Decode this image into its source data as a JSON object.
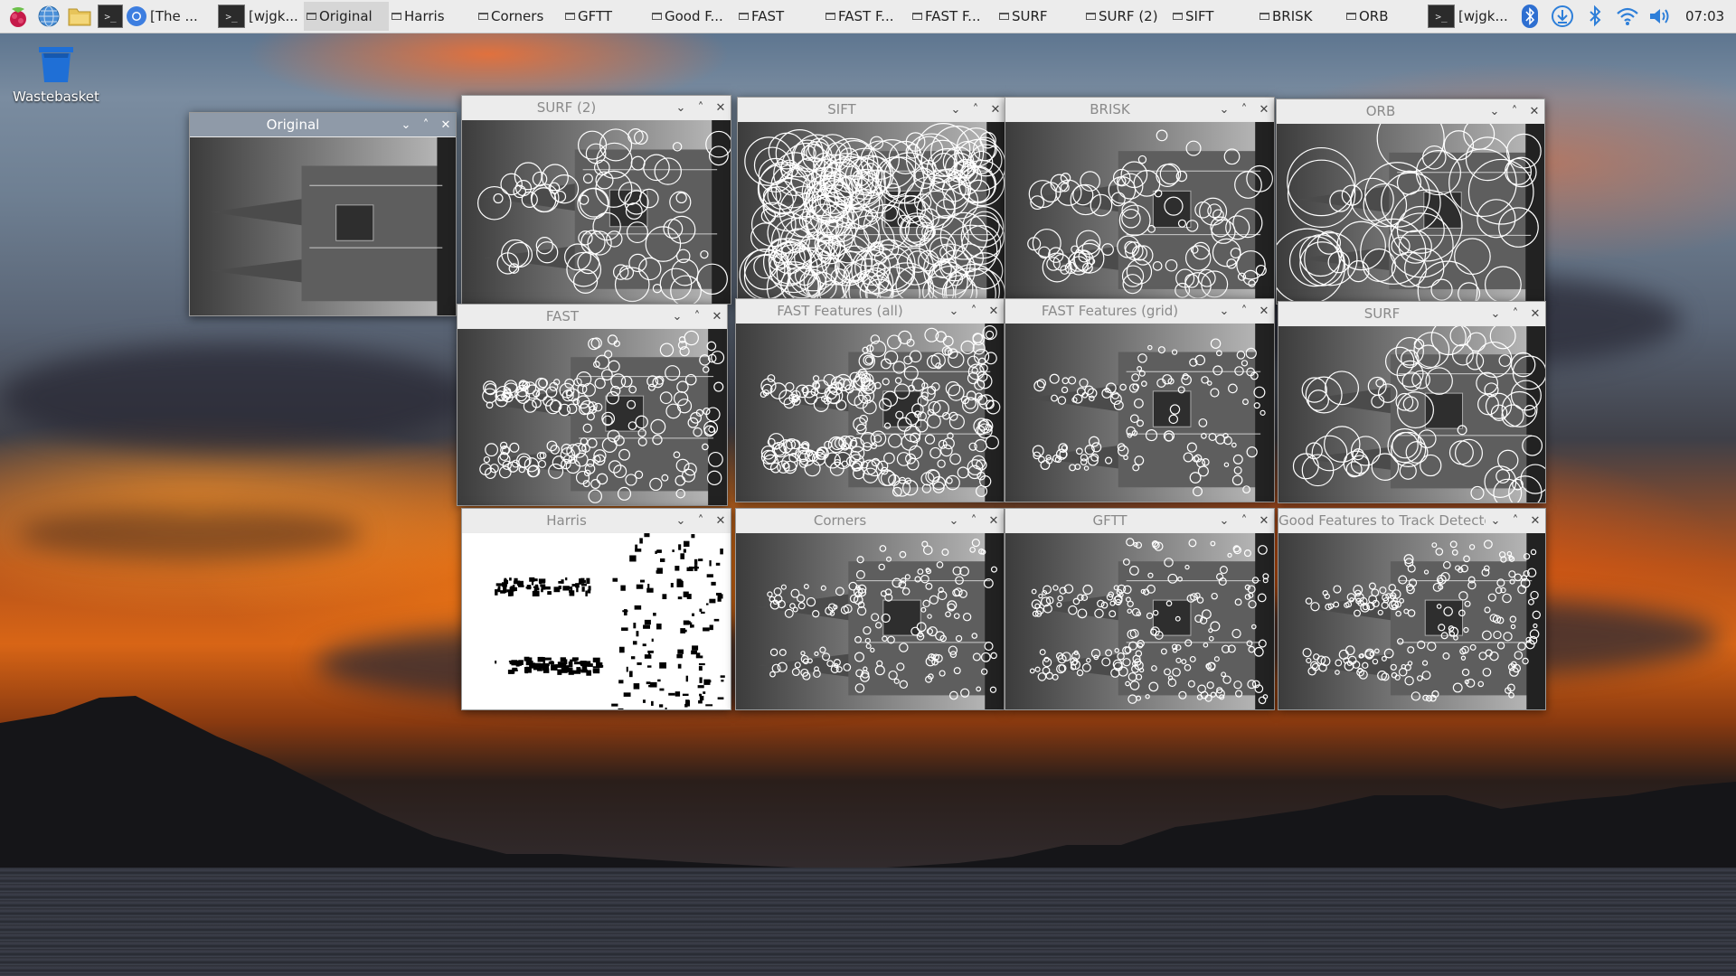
{
  "taskbar": {
    "launchers": [
      {
        "name": "raspberry-menu-icon"
      },
      {
        "name": "web-browser-icon"
      },
      {
        "name": "file-manager-icon"
      },
      {
        "name": "terminal-icon"
      }
    ],
    "tasks": [
      {
        "label": "[The ...",
        "icon": "chromium-icon"
      },
      {
        "label": "[wjgk...",
        "icon": "terminal-icon"
      },
      {
        "label": "Original",
        "icon": "window-icon",
        "active": true
      },
      {
        "label": "Harris",
        "icon": "window-icon"
      },
      {
        "label": "Corners",
        "icon": "window-icon"
      },
      {
        "label": "GFTT",
        "icon": "window-icon"
      },
      {
        "label": "Good F...",
        "icon": "window-icon"
      },
      {
        "label": "FAST",
        "icon": "window-icon"
      },
      {
        "label": "FAST F...",
        "icon": "window-icon"
      },
      {
        "label": "FAST F...",
        "icon": "window-icon"
      },
      {
        "label": "SURF",
        "icon": "window-icon"
      },
      {
        "label": "SURF (2)",
        "icon": "window-icon"
      },
      {
        "label": "SIFT",
        "icon": "window-icon"
      },
      {
        "label": "BRISK",
        "icon": "window-icon"
      },
      {
        "label": "ORB",
        "icon": "window-icon"
      },
      {
        "label": "[wjgk...",
        "icon": "terminal-icon"
      }
    ],
    "tray": [
      "bluetooth-badge-icon",
      "download-icon",
      "bluetooth-icon",
      "wifi-icon",
      "volume-icon"
    ],
    "clock": "07:03"
  },
  "desktop": {
    "trash_label": "Wastebasket"
  },
  "windows": [
    {
      "title": "Original",
      "style": "plain",
      "focused": true
    },
    {
      "title": "SURF (2)",
      "style": "large-circles"
    },
    {
      "title": "SIFT",
      "style": "dense-circles"
    },
    {
      "title": "BRISK",
      "style": "mixed-circles"
    },
    {
      "title": "ORB",
      "style": "huge-circles"
    },
    {
      "title": "FAST",
      "style": "small-circles"
    },
    {
      "title": "FAST Features (all)",
      "style": "dense-small"
    },
    {
      "title": "FAST Features (grid)",
      "style": "sparse-small"
    },
    {
      "title": "SURF",
      "style": "large-circles"
    },
    {
      "title": "Harris",
      "style": "binary"
    },
    {
      "title": "Corners",
      "style": "tiny-circles"
    },
    {
      "title": "GFTT",
      "style": "tiny-grid"
    },
    {
      "title": "Good Features to Track Detector",
      "style": "tiny-grid"
    }
  ],
  "window_controls": {
    "minimize": "⌄",
    "maximize": "˄",
    "close": "✕"
  }
}
